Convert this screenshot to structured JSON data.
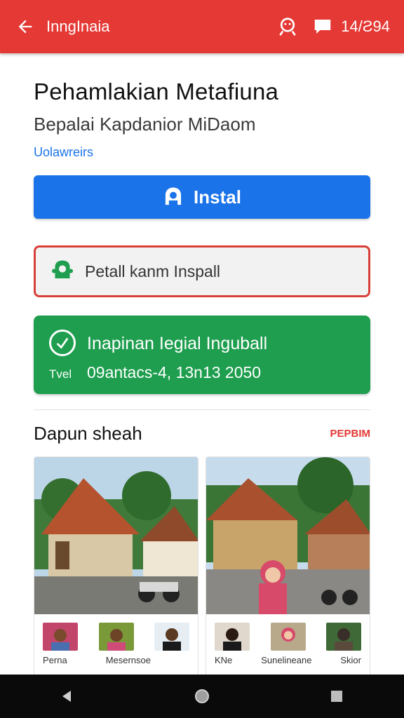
{
  "appbar": {
    "title": "InngInaia",
    "counter": "14/Ƨ94",
    "color": "#e53935"
  },
  "icons": {
    "back": "arrow-left-icon",
    "search": "search-face-icon",
    "message": "message-icon",
    "install": "android-icon",
    "outline": "robot-icon",
    "check": "check-circle-icon"
  },
  "app": {
    "title": "Pehamlakian Metafiuna",
    "subtitle": "Bepalai Kapdanior MiDaom",
    "link": "Uolawreirs"
  },
  "buttons": {
    "install": "Instal",
    "outline": "Petall kanm Inspall"
  },
  "info_card": {
    "line1": "Inapinan Iegial Inguball",
    "tag": "Tvel",
    "line2": "09antacs-4, 13n13 2050"
  },
  "section": {
    "heading": "Dapun sheah",
    "more": "PEPBIM"
  },
  "posts": [
    {
      "names": [
        "Perna",
        "Mesernsoe",
        ""
      ]
    },
    {
      "names": [
        "KNe",
        "Sunelineane",
        "Skior"
      ]
    }
  ],
  "colors": {
    "primary_red": "#e53935",
    "install_blue": "#1a73e8",
    "green": "#1e9e4e",
    "outline_red": "#d9403a"
  }
}
